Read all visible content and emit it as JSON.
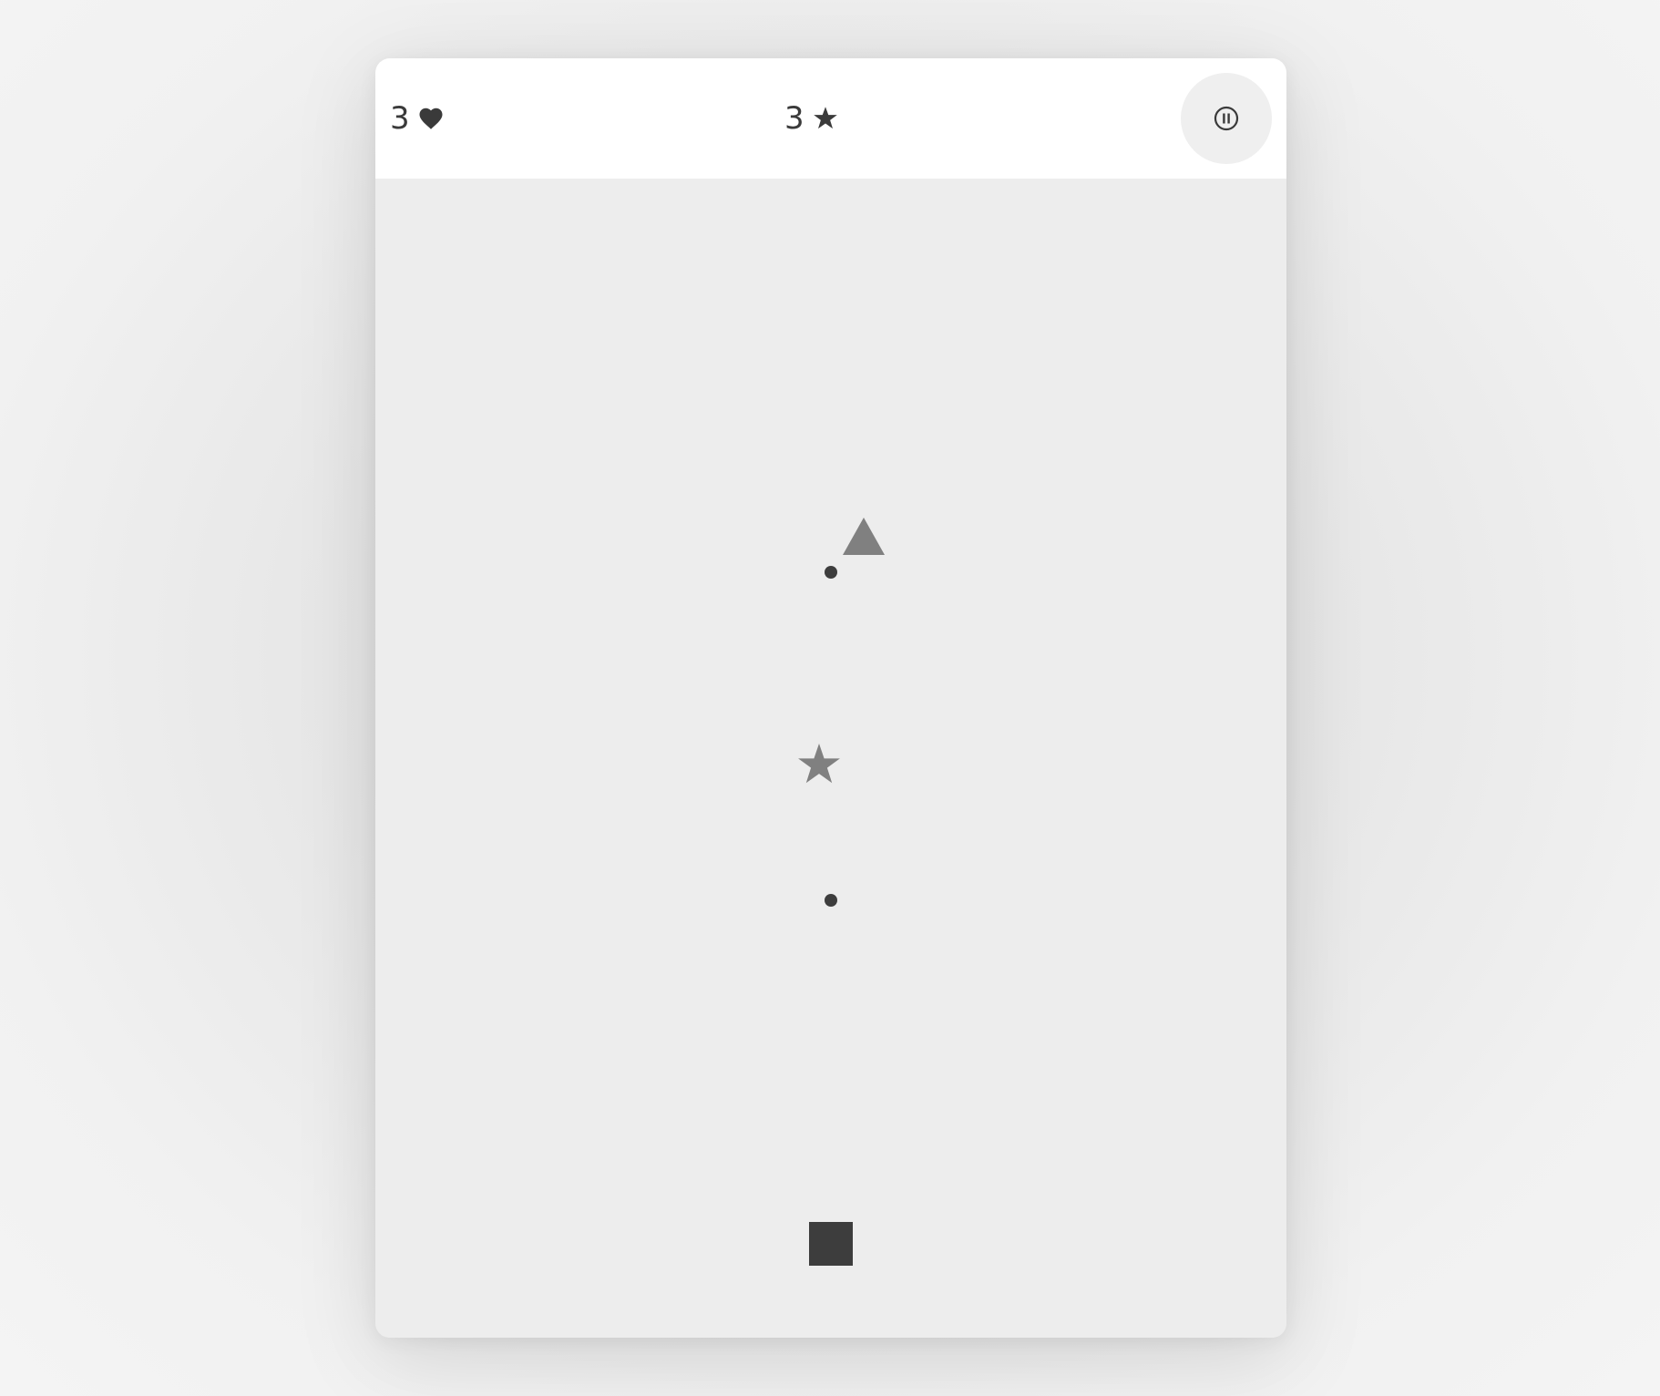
{
  "hud": {
    "lives": "3",
    "lives_icon": "heart-icon",
    "score": "3",
    "score_icon": "star-icon",
    "pause_icon": "pause-icon"
  },
  "playfield": {
    "objects": [
      {
        "kind": "triangle",
        "name": "falling-triangle",
        "color": "#808080"
      },
      {
        "kind": "dot",
        "name": "bullet-dot",
        "color": "#3d3d3d"
      },
      {
        "kind": "star",
        "name": "falling-star",
        "color": "#808080"
      },
      {
        "kind": "dot",
        "name": "bullet-dot",
        "color": "#3d3d3d"
      },
      {
        "kind": "square",
        "name": "player-square",
        "color": "#3d3d3d"
      }
    ]
  },
  "colors": {
    "text": "#3a3a3a",
    "hud_background": "#ffffff",
    "field_background": "#ededed",
    "pause_button_background": "#efefef"
  }
}
